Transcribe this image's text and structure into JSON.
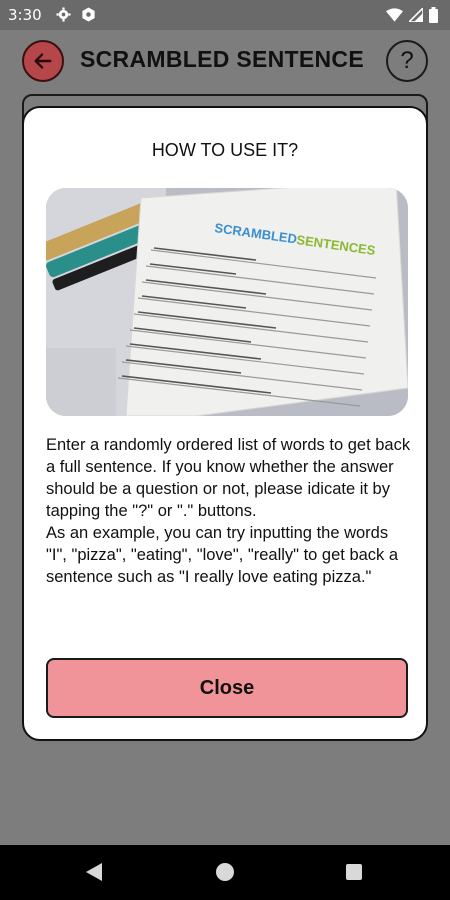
{
  "status_bar": {
    "time": "3:30",
    "icons_left": [
      "gear-icon",
      "settings-icon"
    ],
    "icons_right": [
      "wifi-icon",
      "signal-icon",
      "battery-icon"
    ]
  },
  "app_bar": {
    "title": "SCRAMBLED SENTENCE",
    "back_icon": "arrow-left-icon",
    "help_label": "?"
  },
  "dialog": {
    "title": "HOW TO USE IT?",
    "image": {
      "heading_word_1": "SCRAMBLED",
      "heading_word_2": "SENTENCES"
    },
    "body": "Enter a randomly ordered list of words to get back a full sentence. If you know whether the answer should be a question or not, please idicate it by tapping the \"?\" or \".\" buttons.\nAs an example, you can try inputting the words \"I\", \"pizza\", \"eating\", \"love\", \"really\" to get back a sentence such as \"I really love eating pizza.\"",
    "close_label": "Close"
  },
  "colors": {
    "accent": "#b5474b",
    "close_button": "#f19499",
    "scrim": "#7d7d7d"
  }
}
